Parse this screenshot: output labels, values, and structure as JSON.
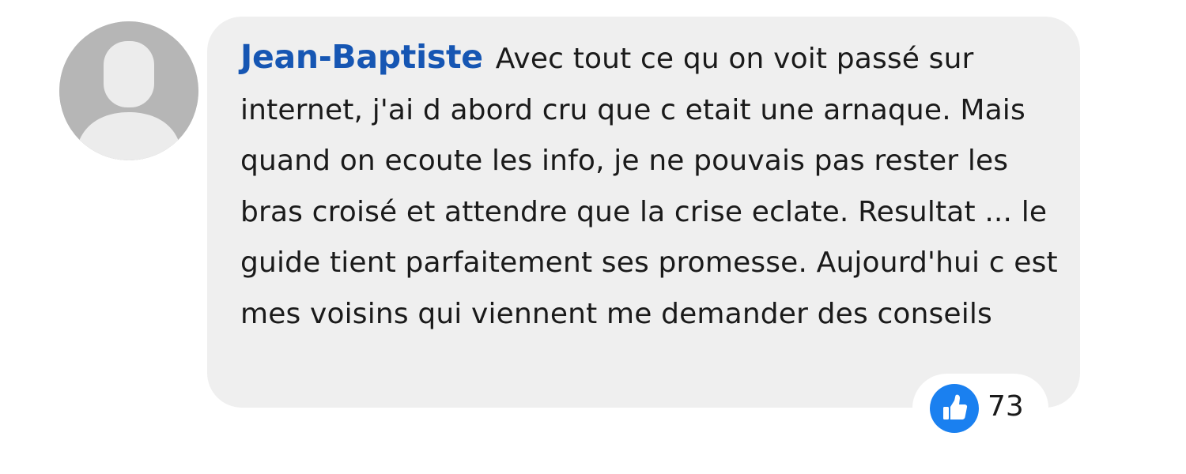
{
  "comment": {
    "author": "Jean-Baptiste",
    "text": "Avec tout ce qu on voit passé sur internet, j'ai d abord cru que c etait une arnaque. Mais quand on ecoute les info, je ne pouvais pas rester les bras croisé et attendre que la crise eclate. Resultat ... le guide tient parfaitement ses promesse. Aujourd'hui c est mes voisins qui viennent me demander des conseils"
  },
  "reactions": {
    "icon": "thumbs-up-icon",
    "count": "73"
  },
  "colors": {
    "author": "#1656b3",
    "bubble": "#efefef",
    "like_badge": "#1a80f0",
    "avatar": "#b6b6b6"
  }
}
